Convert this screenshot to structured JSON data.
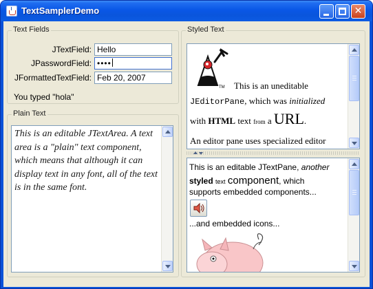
{
  "window": {
    "title": "TextSamplerDemo"
  },
  "text_fields": {
    "group_label": "Text Fields",
    "text_field_label": "JTextField:",
    "text_field_value": "Hello",
    "password_label": "JPasswordField:",
    "password_value": "••••",
    "formatted_label": "JFormattedTextField:",
    "formatted_value": "Feb 20, 2007",
    "typed_message": "You typed \"hola\""
  },
  "plain_text": {
    "group_label": "Plain Text",
    "text": "This is an editable JTextArea. A text area is a \"plain\" text component, which means that although it can display text in any font, all of the text is in the same font."
  },
  "styled_text": {
    "group_label": "Styled Text",
    "editor_pane": {
      "line1": "This is an uneditable",
      "jeditorpane": "JEditorPane",
      "which_was": ", which was ",
      "initialized": "initialized",
      "with": "with ",
      "html": "HTML",
      "text_from": " text ",
      "from": "from",
      "a": " a ",
      "url": "URL",
      "period": ".",
      "line4": "An editor pane uses specialized editor"
    },
    "text_pane": {
      "line1_pre": "This is an editable JTextPane, ",
      "another": "another",
      "styled": "styled",
      "text_small": "text",
      "component": "component",
      "which": ", which",
      "supports": "supports embedded components...",
      "and_icons": "...and embedded icons..."
    }
  },
  "icons": [
    "java-duke-icon",
    "sound-button-icon",
    "pig-icon",
    "minimize-icon",
    "maximize-icon",
    "close-icon"
  ]
}
